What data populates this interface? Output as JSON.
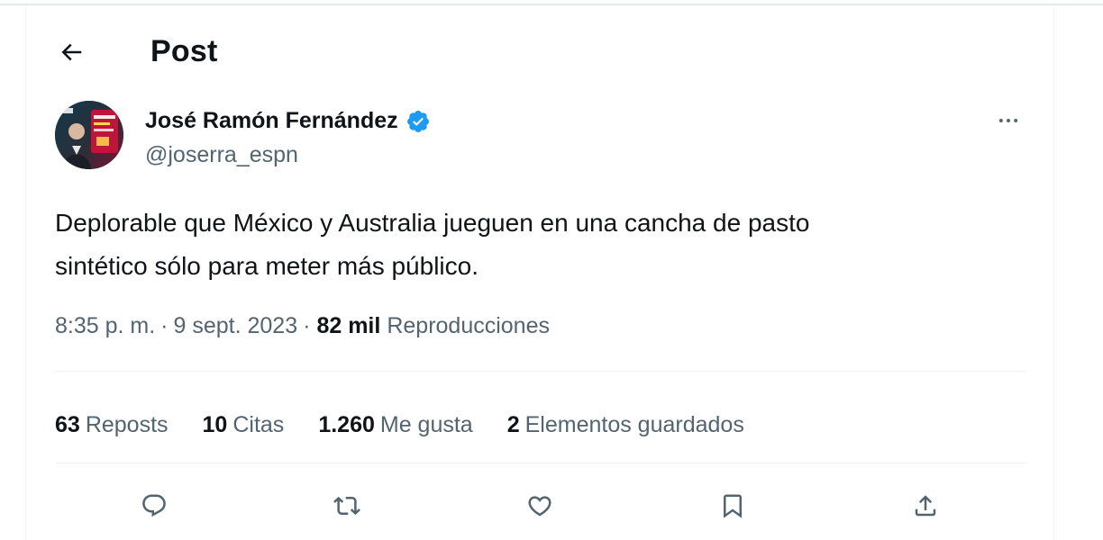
{
  "header": {
    "title": "Post",
    "back_icon": "arrow-left-icon"
  },
  "author": {
    "display_name": "José Ramón Fernández",
    "handle": "@joserra_espn",
    "verified_icon": "verified-badge-icon",
    "verified_color": "#1d9bf0",
    "more_icon": "more-horizontal-icon"
  },
  "tweet": {
    "text_line1": "Deplorable que México y Australia jueguen en una cancha de pasto",
    "text_line2": "sintético sólo para meter más público.",
    "time": "8:35 p. m.",
    "separator": "·",
    "date": "9 sept. 2023",
    "views_count": "82 mil",
    "views_label": "Reproducciones"
  },
  "stats": {
    "reposts": {
      "count": "63",
      "label": "Reposts"
    },
    "quotes": {
      "count": "10",
      "label": "Citas"
    },
    "likes": {
      "count": "1.260",
      "label": "Me gusta"
    },
    "bookmarks": {
      "count": "2",
      "label": "Elementos guardados"
    }
  },
  "actions": {
    "reply_icon": "reply-icon",
    "repost_icon": "repost-icon",
    "like_icon": "heart-icon",
    "bookmark_icon": "bookmark-icon",
    "share_icon": "share-icon"
  },
  "colors": {
    "text_primary": "#0f1419",
    "text_secondary": "#536471",
    "divider": "#eff3f4"
  }
}
